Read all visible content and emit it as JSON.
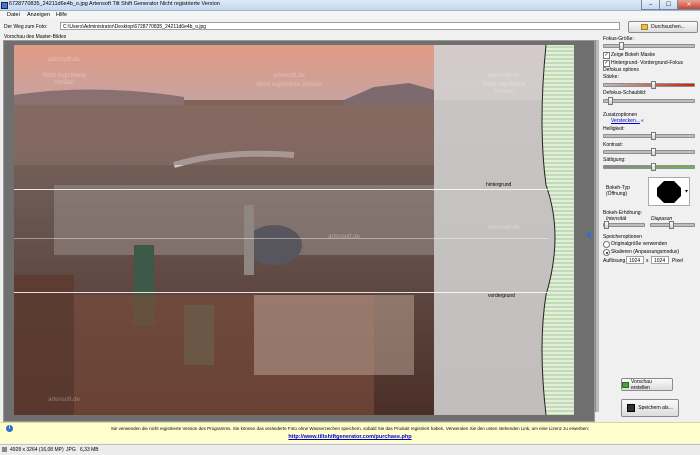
{
  "window": {
    "title": "6728770835_24211d6e4b_o.jpg Artensoft Tilt Shift Generator  Nicht registrierte Version",
    "minimize": "–",
    "maximize": "☐",
    "close": "✕"
  },
  "menu": [
    "Datei",
    "Anzeigen",
    "Hilfe"
  ],
  "path": {
    "label": "Der Weg zum Foto:",
    "value": "C:\\Users\\Administrator\\Desktop\\6728770835_24211d6e4b_o.jpg",
    "browse": "Durchsuchen..."
  },
  "preview": {
    "label": "Vorschau des Master-Bildes",
    "hintergrund": "hintergrund",
    "vordergrund": "vordergrund",
    "watermarks": [
      "artensoft.de",
      "Nicht registrierte Version",
      "artensoft.de",
      "Nicht registrierte Version",
      "artensoft.de",
      "Nicht registrierte Version",
      "artensoft.de",
      "artensoft.de",
      "artensoft.de"
    ]
  },
  "panel": {
    "fokus_groesse": "Fokus-Größe:",
    "zeige_bokeh": "Zeige Bokeh Maske",
    "hint_vord_fokus": "Hintergrund- Vordergrund-Fokus",
    "defokus_options": "Defokus options",
    "staerke": "Stärke:",
    "defokus_schaubild": "Defokus-Schaubild:",
    "zusatzoptionen": "Zusatzoptionen",
    "verstecken": "Verstecken...",
    "verstecken_arrow": "«",
    "helligkeit": "Helligkeit:",
    "kontrast": "Kontrast:",
    "saettigung": "Sättigung:",
    "bokeh_typ": "Bokeh-Typ",
    "oeffnung": "(Öffnung)",
    "bokeh_erhoehung": "Bokeh-Erhöhung:",
    "intensitaet": "Intensität",
    "diapason": "Diapason",
    "speicheroptionen": "Speicheroptionen",
    "originalgroesse": "Originalgröße verwenden",
    "skalieren": "Skalieren (Anpassungsmodus)",
    "aufloesung": "Auflösung",
    "res_w": "1024",
    "x": "x",
    "res_h": "1024",
    "pixel": "Pixel",
    "vorschau_erstellen": "Vorschau erstellen",
    "speichern_als": "Speichern als..."
  },
  "sliders": {
    "fokus_groesse": 0.18,
    "staerke": 0.55,
    "defokus_schaubild": 0.05,
    "helligkeit": 0.55,
    "kontrast": 0.55,
    "saettigung": 0.55,
    "intensitaet": 0.0,
    "diapason": 0.45
  },
  "checks": {
    "zeige_bokeh": true,
    "hint_vord_fokus": true
  },
  "colors": {
    "accent_red": "#cc2200",
    "link_blue": "#0000cc",
    "info_bar": "#ffffcc",
    "green_hatch": "#9ec98c"
  },
  "infobar": {
    "text": "Sie verwenden die nicht registrierte Version des Programms. Sie können das veränderte Foto ohne Wasserzeichen speichern, sobald Sie das Produkt registriert haben. Verwenden Sie den unten stehenden Link, um eine Lizenz zu erwerben:",
    "link": "http://www.tiltshiftgenerator.com/purchase.php"
  },
  "status": {
    "dimensions": "4928 x 3264 (16,08 MP)",
    "format": "JPG",
    "size": "6,33 MB"
  }
}
